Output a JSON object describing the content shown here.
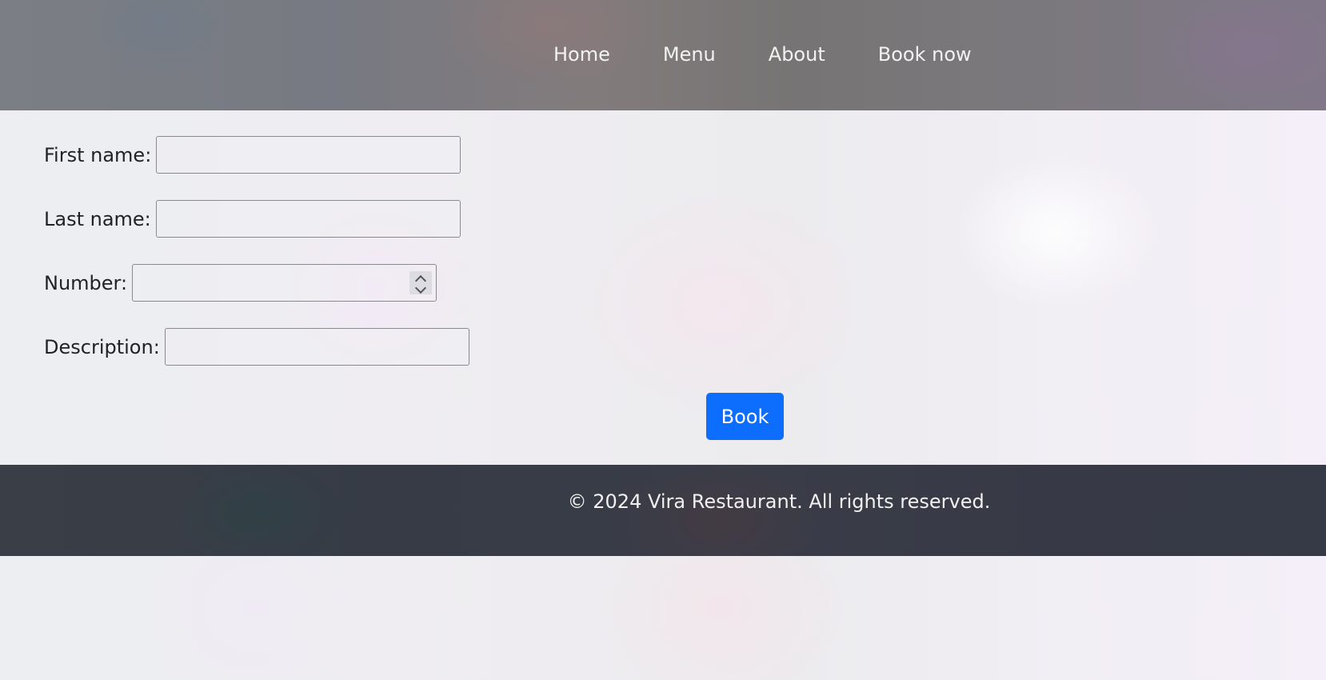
{
  "nav": {
    "items": [
      {
        "label": "Home"
      },
      {
        "label": "Menu"
      },
      {
        "label": "About"
      },
      {
        "label": "Book now"
      }
    ]
  },
  "form": {
    "first_name_label": "First name:",
    "first_name_value": "",
    "last_name_label": "Last name:",
    "last_name_value": "",
    "number_label": "Number:",
    "number_value": "",
    "description_label": "Description:",
    "description_value": "",
    "submit_label": "Book"
  },
  "footer": {
    "copyright": "© 2024 Vira Restaurant. All rights reserved."
  },
  "colors": {
    "button_accent": "#0d6efd",
    "footer_bg": "#393c47",
    "header_bg": "#7a7a80"
  }
}
